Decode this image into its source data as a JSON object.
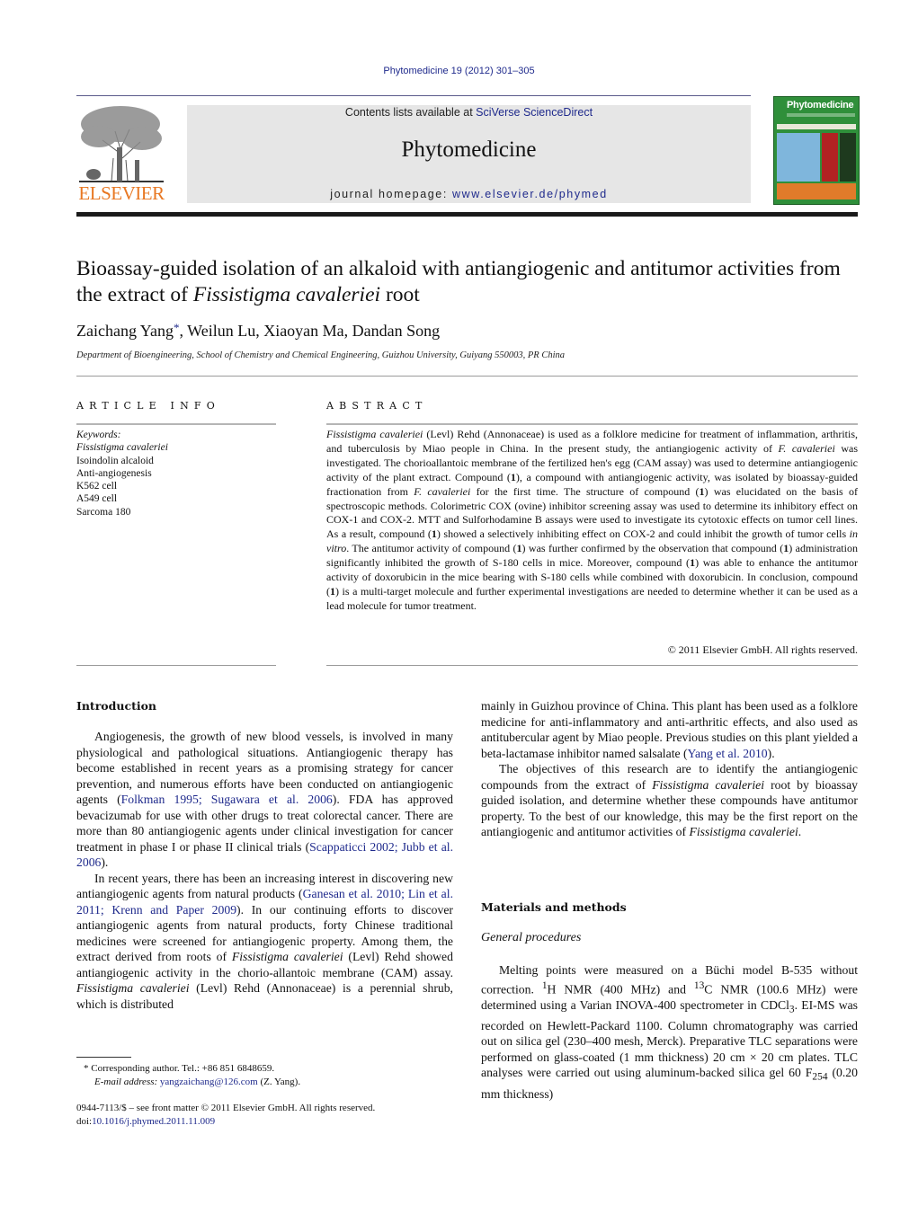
{
  "header": {
    "citation": "Phytomedicine 19 (2012) 301–305",
    "publisher_logo_text": "ELSEVIER",
    "contents_prefix": "Contents lists available at ",
    "contents_link": "SciVerse ScienceDirect",
    "journal_name": "Phytomedicine",
    "homepage_prefix": "journal homepage: ",
    "homepage_link": "www.elsevier.de/phymed",
    "cover_title": "Phytomedicine",
    "colors": {
      "link": "#1f2a8c",
      "elsevier_orange": "#e87722",
      "cover_green": "#2f8f3a",
      "header_box": "#e6e6e6"
    }
  },
  "article": {
    "title_part1": "Bioassay-guided isolation of an alkaloid with antiangiogenic and antitumor activities from the extract of ",
    "title_italic": "Fissistigma cavaleriei",
    "title_part2": " root",
    "authors_first": "Zaichang Yang",
    "authors_marker": "*",
    "authors_rest": ", Weilun Lu, Xiaoyan Ma, Dandan Song",
    "affiliation": "Department of Bioengineering, School of Chemistry and Chemical Engineering, Guizhou University, Guiyang 550003, PR China"
  },
  "article_info": {
    "heading": "ARTICLE INFO",
    "keywords_label": "Keywords:",
    "keywords": [
      "Fissistigma cavaleriei",
      "Isoindolin alcaloid",
      "Anti-angiogenesis",
      "K562 cell",
      "A549 cell",
      "Sarcoma 180"
    ]
  },
  "abstract": {
    "heading": "ABSTRACT",
    "s1_it": "Fissistigma cavaleriei",
    "s1": " (Levl) Rehd (Annonaceae) is used as a folklore medicine for treatment of inflammation, arthritis, and tuberculosis by Miao people in China. In the present study, the antiangiogenic activity of ",
    "s2_it": "F. cavaleriei",
    "s2": " was investigated. The chorioallantoic membrane of the fertilized hen's egg (CAM assay) was used to determine antiangiogenic activity of the plant extract. Compound (",
    "b1": "1",
    "s3": "), a compound with antiangiogenic activity, was isolated by bioassay-guided fractionation from ",
    "s3_it": "F. cavaleriei",
    "s4": " for the first time. The structure of compound (",
    "s5": ") was elucidated on the basis of spectroscopic methods. Colorimetric COX (ovine) inhibitor screening assay was used to determine its inhibitory effect on COX-1 and COX-2. MTT and Sulforhodamine B assays were used to investigate its cytotoxic effects on tumor cell lines. As a result, compound (",
    "s6": ") showed a selectively inhibiting effect on COX-2 and could inhibit the growth of tumor cells ",
    "s6_it": "in vitro",
    "s7": ". The antitumor activity of compound (",
    "s8": ") was further confirmed by the observation that compound (",
    "s9": ") administration significantly inhibited the growth of S-180 cells in mice. Moreover, compound (",
    "s10": ") was able to enhance the antitumor activity of doxorubicin in the mice bearing with S-180 cells while combined with doxorubicin. In conclusion, compound (",
    "s11": ") is a multi-target molecule and further experimental investigations are needed to determine whether it can be used as a lead molecule for tumor treatment.",
    "copyright": "© 2011 Elsevier GmbH. All rights reserved."
  },
  "introduction": {
    "heading": "Introduction",
    "p1a": "Angiogenesis, the growth of new blood vessels, is involved in many physiological and pathological situations. Antiangiogenic therapy has become established in recent years as a promising strategy for cancer prevention, and numerous efforts have been conducted on antiangiogenic agents (",
    "p1_ref1": "Folkman 1995; Sugawara et al. 2006",
    "p1b": "). FDA has approved bevacizumab for use with other drugs to treat colorectal cancer. There are more than 80 antiangiogenic agents under clinical investigation for cancer treatment in phase I or phase II clinical trials (",
    "p1_ref2": "Scappaticci 2002; Jubb et al. 2006",
    "p1c": ").",
    "p2a": "In recent years, there has been an increasing interest in discovering new antiangiogenic agents from natural products (",
    "p2_ref": "Ganesan et al. 2010; Lin et al. 2011; Krenn and Paper 2009",
    "p2b": "). In our continuing efforts to discover antiangiogenic agents from natural products, forty Chinese traditional medicines were screened for antiangiogenic property. Among them, the extract derived from roots of ",
    "p2_it1": "Fissistigma cavaleriei",
    "p2c": " (Levl) Rehd showed antiangiogenic activity in the chorio-allantoic membrane (CAM) assay. ",
    "p2_it2": "Fissistigma cavaleriei",
    "p2d": " (Levl) Rehd (Annonaceae) is a perennial shrub, which is distributed",
    "p3a": "mainly in Guizhou province of China. This plant has been used as a folklore medicine for anti-inflammatory and anti-arthritic effects, and also used as antitubercular agent by Miao people. Previous studies on this plant yielded a beta-lactamase inhibitor named salsalate (",
    "p3_ref": "Yang et al. 2010",
    "p3b": ").",
    "p4a": "The objectives of this research are to identify the antiangiogenic compounds from the extract of ",
    "p4_it": "Fissistigma cavaleriei",
    "p4b": " root by bioassay guided isolation, and determine whether these compounds have antitumor property. To the best of our knowledge, this may be the first report on the antiangiogenic and antitumor activities of ",
    "p4_it2": "Fissistigma cavaleriei",
    "p4c": "."
  },
  "methods": {
    "heading": "Materials and methods",
    "subheading": "General procedures",
    "p1a": "Melting points were measured on a Büchi model B-535 without correction. ",
    "sup1": "1",
    "p1b": "H NMR (400 MHz) and ",
    "sup2": "13",
    "p1c": "C NMR (100.6 MHz) were determined using a Varian INOVA-400 spectrometer in CDCl",
    "sub1": "3",
    "p1d": ". EI-MS was recorded on Hewlett-Packard 1100. Column chromatography was carried out on silica gel (230–400 mesh, Merck). Preparative TLC separations were performed on glass-coated (1 mm thickness) 20 cm × 20 cm plates. TLC analyses were carried out using aluminum-backed silica gel 60 F",
    "sub2": "254",
    "p1e": " (0.20 mm thickness)"
  },
  "footnotes": {
    "marker": "*",
    "corresponding": "Corresponding author. Tel.: +86 851 6848659.",
    "email_label": "E-mail address:",
    "email": "yangzaichang@126.com",
    "email_suffix": " (Z. Yang).",
    "issn_line": "0944-7113/$ – see front matter © 2011 Elsevier GmbH. All rights reserved.",
    "doi_prefix": "doi:",
    "doi": "10.1016/j.phymed.2011.11.009"
  }
}
